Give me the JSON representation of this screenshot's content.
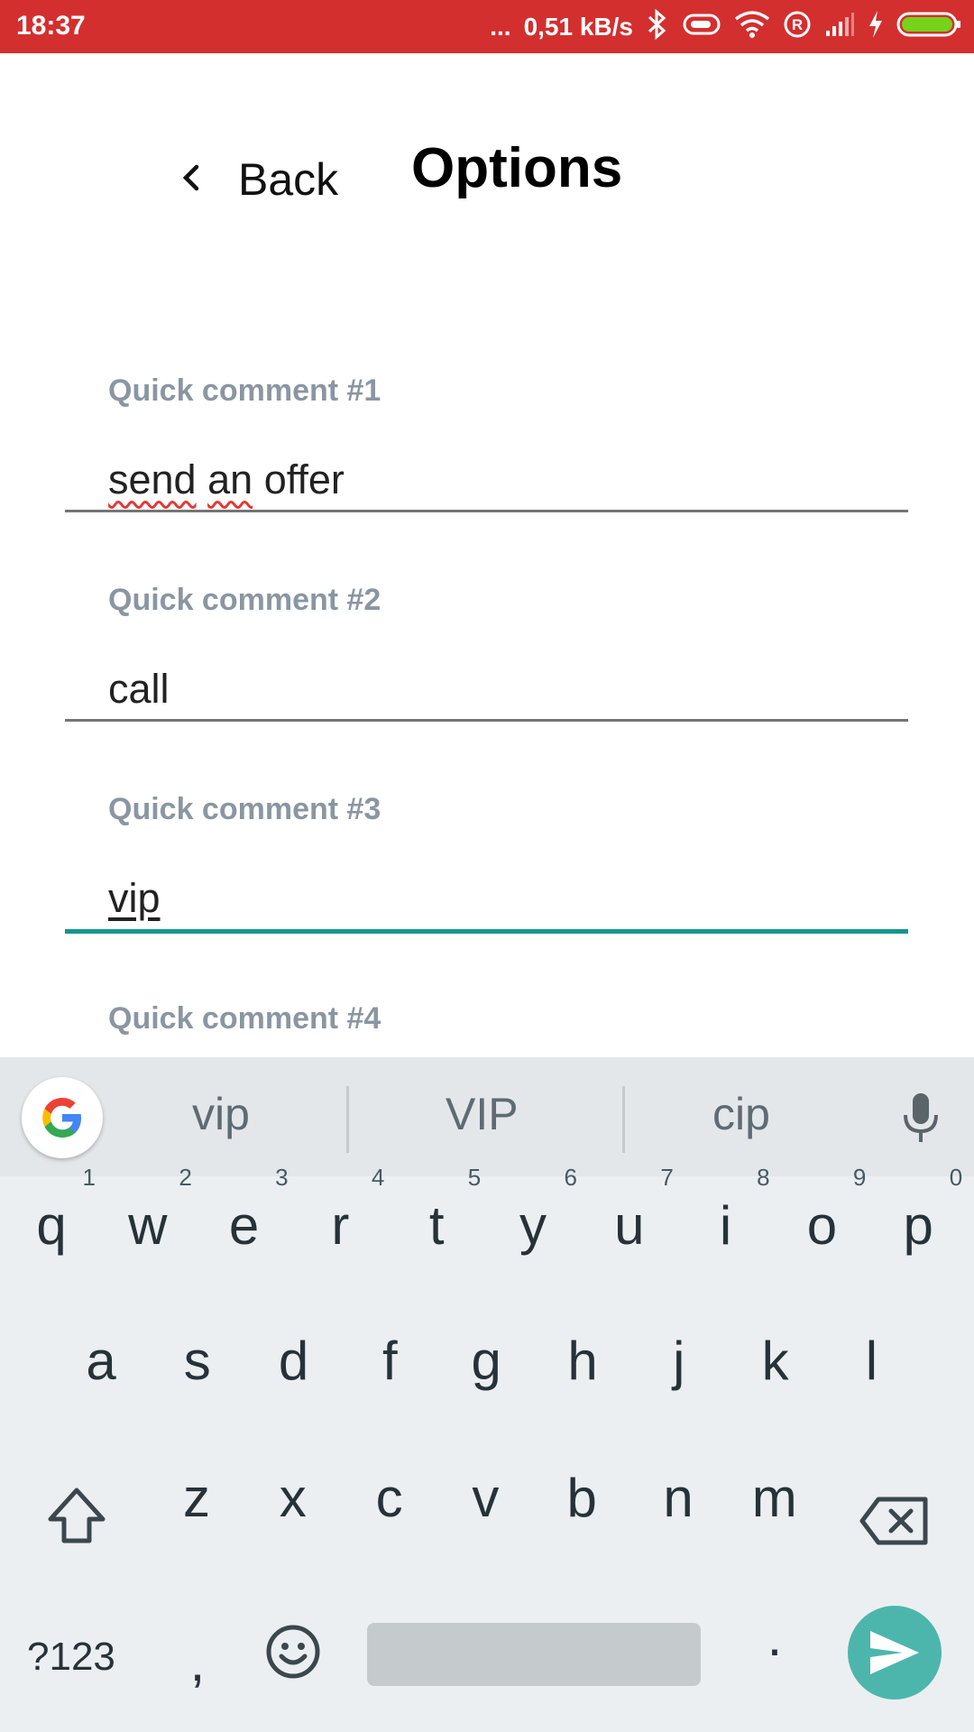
{
  "status_bar": {
    "time": "18:37",
    "dots": "...",
    "net_speed": "0,51 kB/s",
    "icons": [
      "bluetooth-icon",
      "vpn-icon",
      "wifi-icon",
      "roaming-icon",
      "signal-icon",
      "charging-icon",
      "battery-icon"
    ],
    "background_color": "#d32f2f",
    "battery_color": "#76d21a"
  },
  "header": {
    "back_label": "Back",
    "title": "Options"
  },
  "fields": [
    {
      "label": "Quick comment #1",
      "value_parts": [
        "send",
        "an",
        "offer"
      ],
      "active": false
    },
    {
      "label": "Quick comment #2",
      "value": "call",
      "active": false
    },
    {
      "label": "Quick comment #3",
      "value": "vip",
      "active": true
    },
    {
      "label": "Quick comment #4"
    }
  ],
  "keyboard": {
    "suggestions": [
      "vip",
      "VIP",
      "cip"
    ],
    "row1": [
      {
        "k": "q",
        "n": "1"
      },
      {
        "k": "w",
        "n": "2"
      },
      {
        "k": "e",
        "n": "3"
      },
      {
        "k": "r",
        "n": "4"
      },
      {
        "k": "t",
        "n": "5"
      },
      {
        "k": "y",
        "n": "6"
      },
      {
        "k": "u",
        "n": "7"
      },
      {
        "k": "i",
        "n": "8"
      },
      {
        "k": "o",
        "n": "9"
      },
      {
        "k": "p",
        "n": "0"
      }
    ],
    "row2": [
      "a",
      "s",
      "d",
      "f",
      "g",
      "h",
      "j",
      "k",
      "l"
    ],
    "row3": [
      "z",
      "x",
      "c",
      "v",
      "b",
      "n",
      "m"
    ],
    "symbols_label": "?123",
    "comma": ",",
    "period": ".",
    "accent_color": "#4db6ac",
    "active_line_color": "#15968b"
  }
}
